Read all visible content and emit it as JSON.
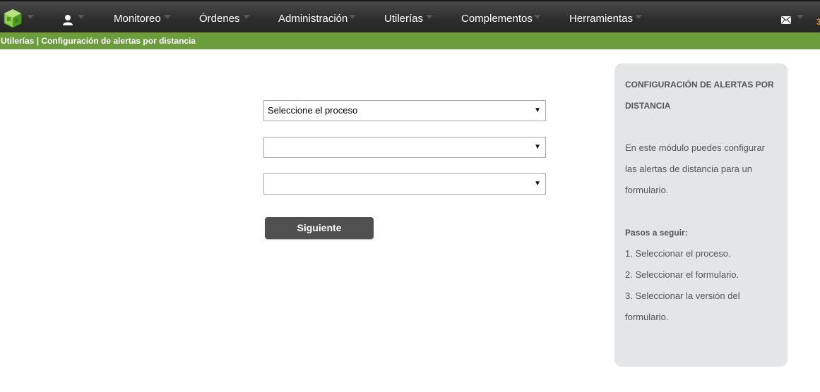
{
  "nav": {
    "items": [
      {
        "label": "Monitoreo"
      },
      {
        "label": "Órdenes"
      },
      {
        "label": "Administración"
      },
      {
        "label": "Utilerías"
      },
      {
        "label": "Complementos"
      },
      {
        "label": "Herramientas"
      }
    ],
    "edge_char": "3"
  },
  "breadcrumb": "Utilerías | Configuración de alertas por distancia",
  "form": {
    "process_select": "Seleccione el proceso",
    "form_select": "",
    "version_select": "",
    "next_button": "Siguiente"
  },
  "help": {
    "title_line1": "CONFIGURACIÓN DE ALERTAS POR",
    "title_line2": "DISTANCIA",
    "desc_line1": "En este módulo puedes configurar",
    "desc_line2": "las alertas de distancia para un",
    "desc_line3": "formulario.",
    "steps_title": "Pasos a seguir:",
    "step1": "1. Seleccionar el proceso.",
    "step2": "2. Seleccionar el formulario.",
    "step3_line1": "3. Seleccionar la versión del",
    "step3_line2": "formulario."
  },
  "colors": {
    "topbar": "#2e2e2e",
    "breadcrumb_bg": "#6b9d3d",
    "panel_bg": "#e4e5e7",
    "button_bg": "#505050",
    "logo_green": "#6fbf3a"
  }
}
